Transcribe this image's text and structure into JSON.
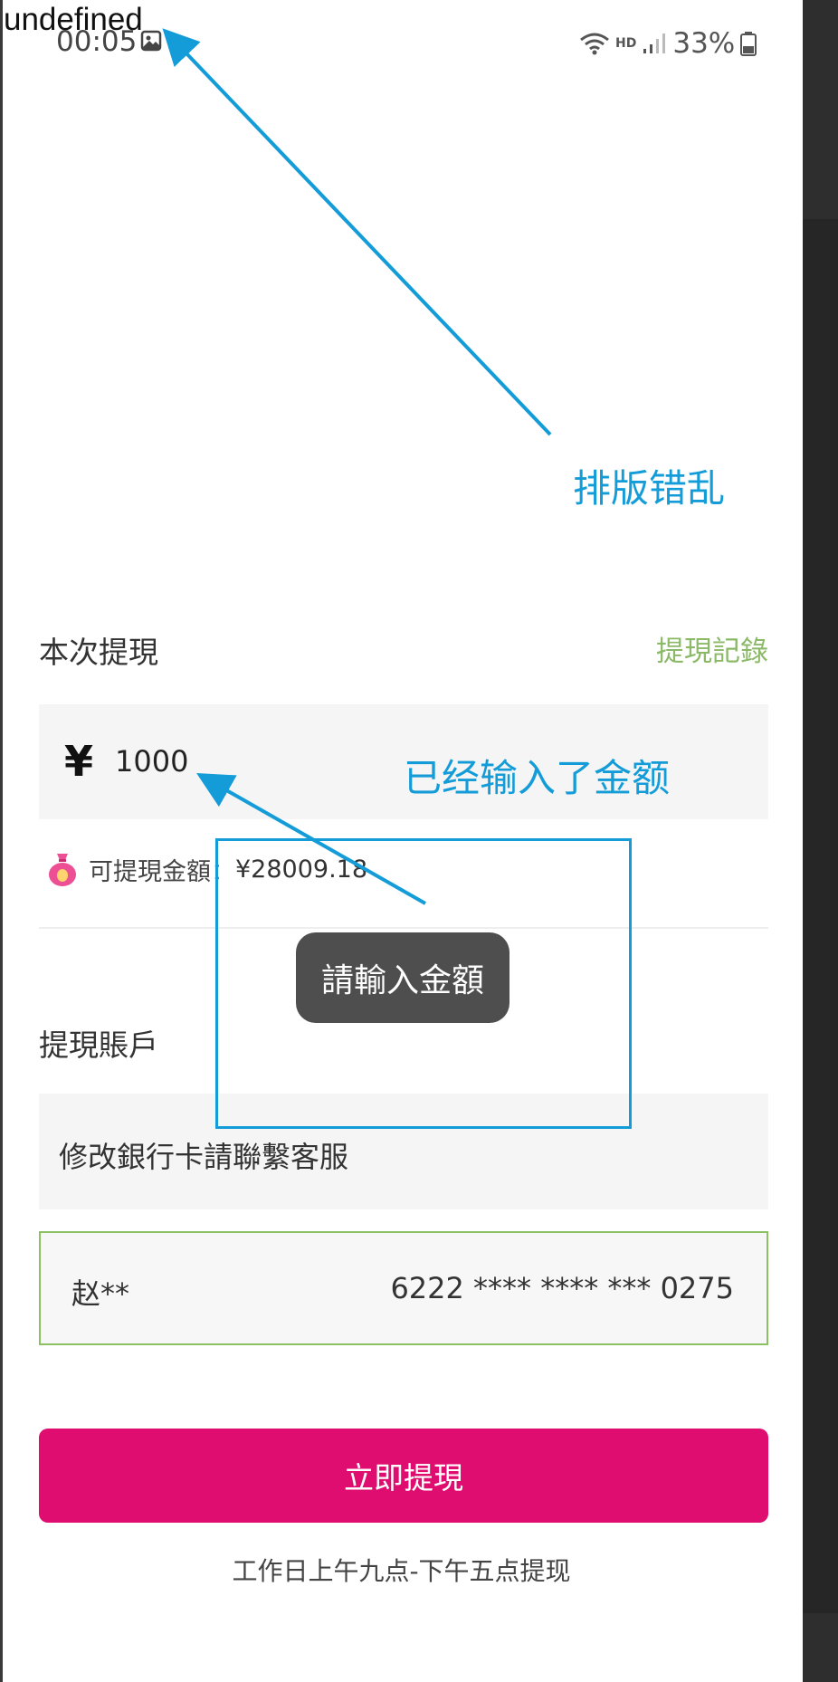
{
  "debug_text": "undefined",
  "status_bar": {
    "time": "00:05",
    "network": "HD",
    "battery": "33%"
  },
  "withdraw": {
    "section_title": "本次提現",
    "records_link": "提現記錄",
    "currency_symbol": "¥",
    "amount_value": "1000",
    "available_label": "可提現金額：",
    "available_value": "¥28009.18"
  },
  "account": {
    "section_title": "提現賬戶",
    "note": "修改銀行卡請聯繫客服",
    "card_holder": "赵**",
    "card_number": "6222 **** **** *** 0275"
  },
  "submit_label": "立即提現",
  "hours_note": "工作日上午九点-下午五点提现",
  "toast": "請輸入金額",
  "annotations": {
    "layout_error": "排版错乱",
    "amount_entered": "已经输入了金额"
  },
  "colors": {
    "accent_pink": "#e00d71",
    "accent_green": "#8bc162",
    "annotation_blue": "#139cd8"
  }
}
